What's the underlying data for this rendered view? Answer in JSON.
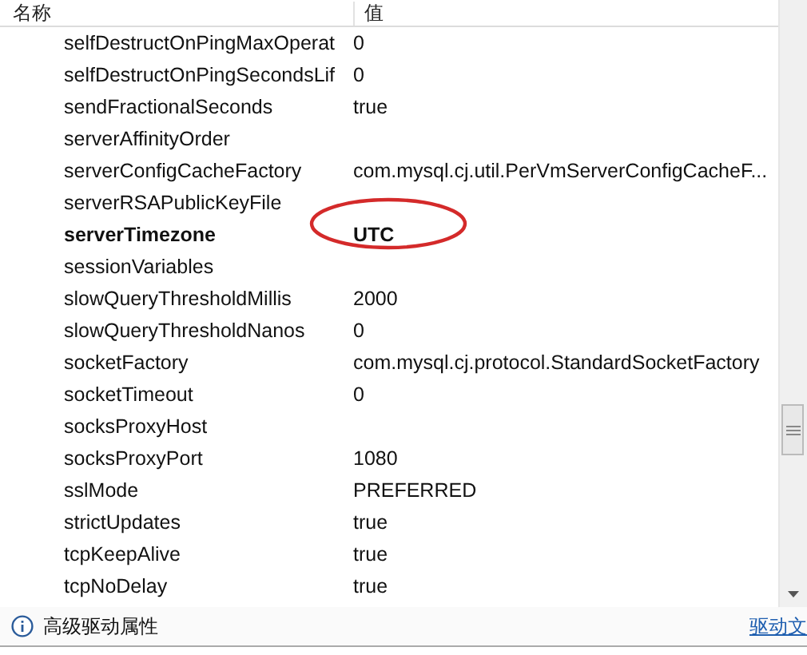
{
  "table": {
    "columns": [
      "名称",
      "值"
    ],
    "rows": [
      {
        "name": "selfDestructOnPingMaxOperat",
        "value": "0",
        "bold": false,
        "circled": false
      },
      {
        "name": "selfDestructOnPingSecondsLif",
        "value": "0",
        "bold": false,
        "circled": false
      },
      {
        "name": "sendFractionalSeconds",
        "value": "true",
        "bold": false,
        "circled": false
      },
      {
        "name": "serverAffinityOrder",
        "value": "",
        "bold": false,
        "circled": false
      },
      {
        "name": "serverConfigCacheFactory",
        "value": "com.mysql.cj.util.PerVmServerConfigCacheF...",
        "bold": false,
        "circled": false
      },
      {
        "name": "serverRSAPublicKeyFile",
        "value": "",
        "bold": false,
        "circled": false
      },
      {
        "name": "serverTimezone",
        "value": "UTC",
        "bold": true,
        "circled": true
      },
      {
        "name": "sessionVariables",
        "value": "",
        "bold": false,
        "circled": false
      },
      {
        "name": "slowQueryThresholdMillis",
        "value": "2000",
        "bold": false,
        "circled": false
      },
      {
        "name": "slowQueryThresholdNanos",
        "value": "0",
        "bold": false,
        "circled": false
      },
      {
        "name": "socketFactory",
        "value": "com.mysql.cj.protocol.StandardSocketFactory",
        "bold": false,
        "circled": false
      },
      {
        "name": "socketTimeout",
        "value": "0",
        "bold": false,
        "circled": false
      },
      {
        "name": "socksProxyHost",
        "value": "",
        "bold": false,
        "circled": false
      },
      {
        "name": "socksProxyPort",
        "value": "1080",
        "bold": false,
        "circled": false
      },
      {
        "name": "sslMode",
        "value": "PREFERRED",
        "bold": false,
        "circled": false
      },
      {
        "name": "strictUpdates",
        "value": "true",
        "bold": false,
        "circled": false
      },
      {
        "name": "tcpKeepAlive",
        "value": "true",
        "bold": false,
        "circled": false
      },
      {
        "name": "tcpNoDelay",
        "value": "true",
        "bold": false,
        "circled": false
      }
    ]
  },
  "footer": {
    "label": "高级驱动属性",
    "link": "驱动文"
  }
}
